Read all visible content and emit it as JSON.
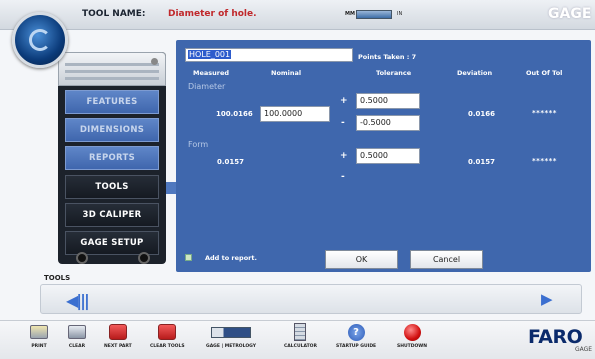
{
  "header": {
    "tool_name_label": "TOOL NAME:",
    "tool_name_value": "Diameter of hole.",
    "units_mm": "MM",
    "units_in": "IN",
    "brand": "GAGE"
  },
  "sidebar": {
    "items": [
      {
        "label": "FEATURES"
      },
      {
        "label": "DIMENSIONS"
      },
      {
        "label": "REPORTS"
      },
      {
        "label": "TOOLS"
      },
      {
        "label": "3D CALIPER"
      },
      {
        "label": "GAGE SETUP"
      }
    ]
  },
  "dialog": {
    "feature_name": "HOLE_001",
    "points_taken": "Points Taken : 7",
    "columns": {
      "measured": "Measured",
      "nominal": "Nominal",
      "tolerance": "Tolerance",
      "deviation": "Deviation",
      "out_of_tol": "Out Of Tol"
    },
    "diameter": {
      "section": "Diameter",
      "measured": "100.0166",
      "nominal": "100.0000",
      "plus_sign": "+",
      "minus_sign": "-",
      "tol_plus": "0.5000",
      "tol_minus": "-0.5000",
      "deviation": "0.0166",
      "out_of_tol": "******"
    },
    "form": {
      "section": "Form",
      "measured": "0.0157",
      "plus_sign": "+",
      "minus_sign": "-",
      "tol_plus": "0.5000",
      "deviation": "0.0157",
      "out_of_tol": "******"
    },
    "add_to_report": "Add to report.",
    "ok": "OK",
    "cancel": "Cancel"
  },
  "tools_panel": {
    "label": "TOOLS",
    "left_glyph": "◀|||",
    "right_glyph": "▶"
  },
  "toolbar": [
    {
      "label": "PRINT",
      "icon": "printer-icon",
      "glyph": "🖨"
    },
    {
      "label": "CLEAR",
      "icon": "clear-icon",
      "glyph": "🖨"
    },
    {
      "label": "NEXT PART",
      "icon": "next-part-icon",
      "glyph": "■"
    },
    {
      "label": "CLEAR TOOLS",
      "icon": "clear-tools-icon",
      "glyph": "■"
    },
    {
      "label": "GAGE | METROLOGY",
      "icon": "mode-toggle-icon",
      "glyph": ""
    },
    {
      "label": "CALCULATOR",
      "icon": "calculator-icon",
      "glyph": "▦"
    },
    {
      "label": "STARTUP GUIDE",
      "icon": "help-icon",
      "glyph": "?"
    },
    {
      "label": "SHUTDOWN",
      "icon": "shutdown-icon",
      "glyph": ""
    }
  ],
  "footer_brand": "FARO",
  "footer_brand_sub": "GAGE",
  "colors": {
    "panel_blue": "#3f67ad",
    "tool_name_red": "#c0282b",
    "nav_dark": "#151a22"
  }
}
